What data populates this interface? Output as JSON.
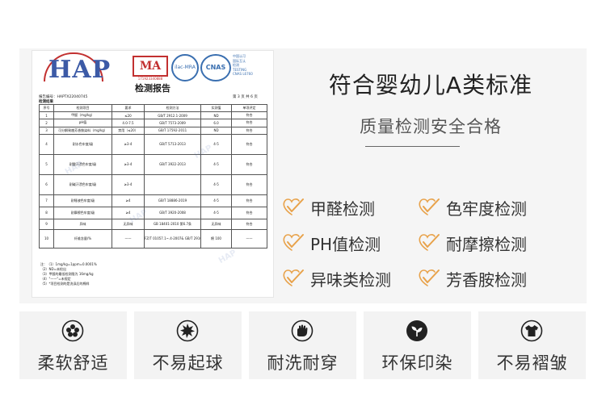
{
  "report": {
    "logo_hap": "HAP",
    "logo_ma": "MA",
    "logo_ma_num": "171923340888",
    "logo_ilac": "ilac-MRA",
    "logo_cnas": "CNAS",
    "cnas_text": [
      "中国认可",
      "国际互认",
      "检测",
      "TESTING",
      "CNAS L6760"
    ],
    "title": "检测报告",
    "report_no": "报告编号：HAPTX22040745",
    "page_no": "第 3 页 共 6 页",
    "result_label": "检测结果",
    "headers": [
      "序号",
      "检测项目",
      "要求",
      "检测方法",
      "实测值",
      "单项评定"
    ],
    "rows": [
      [
        "1",
        "甲醛（mg/kg）",
        "≤20",
        "GB/T 2912.1-2009",
        "ND",
        "符合"
      ],
      [
        "2",
        "pH值",
        "4.0-7.5",
        "GB/T 7573-2009",
        "6.0",
        "符合"
      ],
      [
        "3",
        "可分解致癌芳香胺染料（mg/kg）",
        "禁用（≤20）",
        "GB/T 17592-2011",
        "ND",
        "符合"
      ],
      [
        "4",
        "耐水色牢度/级",
        "≥3-4",
        "GB/T 5713-2013",
        "4-5",
        "符合"
      ],
      [
        "5",
        "耐酸汗渍色牢度/级",
        "≥3-4",
        "GB/T 3922-2013",
        "4-5",
        "符合"
      ],
      [
        "6",
        "耐碱汗渍色牢度/级",
        "≥3-4",
        "",
        "4-5",
        "符合"
      ],
      [
        "7",
        "耐唾液色牢度/级",
        "≥4",
        "GB/T 18886-2019",
        "4-5",
        "符合"
      ],
      [
        "8",
        "耐摩擦色牢度/级",
        "≥4",
        "GB/T 3920-2008",
        "4-5",
        "符合"
      ],
      [
        "9",
        "异味",
        "无异味",
        "GB 18401-2010 第6.7条",
        "无异味",
        "符合"
      ],
      [
        "10",
        "纤维含量/%",
        "——",
        "FZ/T 01057.1~.4-2007& GB/T 2910-2009",
        "棉 100",
        "——"
      ]
    ],
    "notes": [
      "注：（1）1mg/kg=1ppm=0.0001%",
      "（2）ND=未检出",
      "（3）甲醛的最低检测限为 16mg/kg",
      "（4）\"——\"=未规定",
      "（5）*项目检测的是洗涤后的棉样"
    ],
    "watermark": "HAP"
  },
  "heading": "符合婴幼儿A类标准",
  "subheading": "质量检测安全合格",
  "checks": [
    {
      "label": "甲醛检测",
      "icon": "check-heart-icon"
    },
    {
      "label": "色牢度检测",
      "icon": "check-heart-icon"
    },
    {
      "label": "PH值检测",
      "icon": "check-heart-icon"
    },
    {
      "label": "耐摩擦检测",
      "icon": "check-heart-icon"
    },
    {
      "label": "异味类检测",
      "icon": "check-heart-icon"
    },
    {
      "label": "芳香胺检测",
      "icon": "check-heart-icon"
    }
  ],
  "features": [
    {
      "label": "柔软舒适",
      "icon": "flower-icon"
    },
    {
      "label": "不易起球",
      "icon": "burst-ball-icon"
    },
    {
      "label": "耐洗耐穿",
      "icon": "hand-wash-icon"
    },
    {
      "label": "环保印染",
      "icon": "leaf-icon"
    },
    {
      "label": "不易褶皱",
      "icon": "tshirt-icon"
    }
  ],
  "colors": {
    "accent_orange": "#e8a24a",
    "feature_bg": "#f3f3f3",
    "band_bg": "#f5f5f5",
    "text_dark": "#222222",
    "logo_blue": "#3c5aa6",
    "logo_red": "#c23030"
  }
}
